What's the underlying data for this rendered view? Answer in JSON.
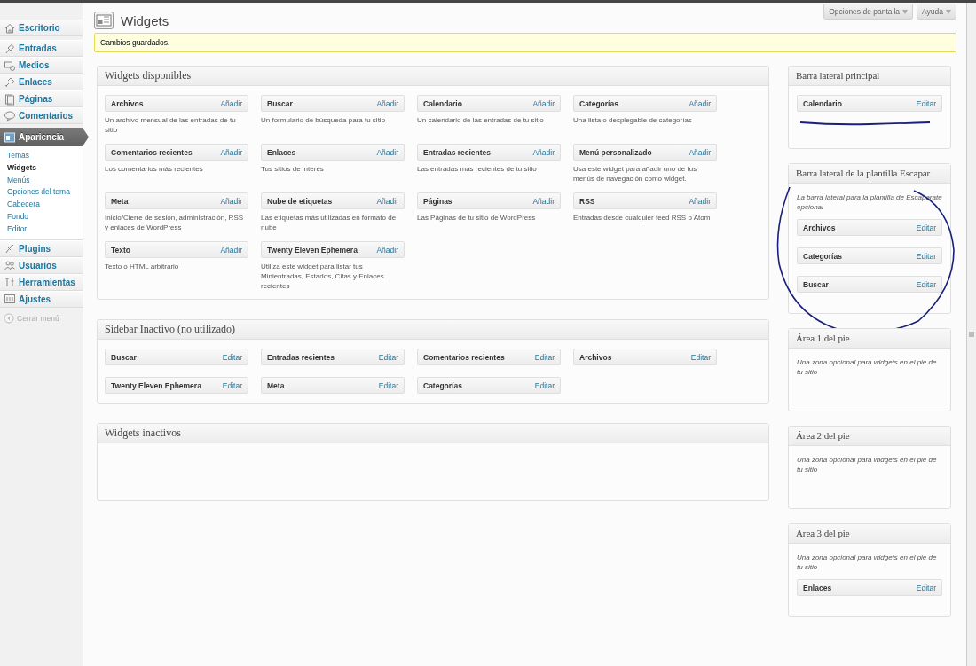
{
  "admin_menu": {
    "groups": [
      [
        {
          "label": "Escritorio",
          "selected": false
        }
      ],
      [
        {
          "label": "Entradas",
          "selected": false
        },
        {
          "label": "Medios",
          "selected": false
        },
        {
          "label": "Enlaces",
          "selected": false
        },
        {
          "label": "Páginas",
          "selected": false
        },
        {
          "label": "Comentarios",
          "selected": false
        }
      ],
      [
        {
          "label": "Apariencia",
          "selected": true,
          "children": [
            {
              "label": "Temas",
              "selected": false
            },
            {
              "label": "Widgets",
              "selected": true
            },
            {
              "label": "Menús",
              "selected": false
            },
            {
              "label": "Opciones del tema",
              "selected": false
            },
            {
              "label": "Cabecera",
              "selected": false
            },
            {
              "label": "Fondo",
              "selected": false
            },
            {
              "label": "Editor",
              "selected": false
            }
          ]
        },
        {
          "label": "Plugins",
          "selected": false
        },
        {
          "label": "Usuarios",
          "selected": false
        },
        {
          "label": "Herramientas",
          "selected": false
        },
        {
          "label": "Ajustes",
          "selected": false
        }
      ]
    ],
    "collapse": "Cerrar menú"
  },
  "header": {
    "title": "Widgets",
    "screen_options": "Opciones de pantalla",
    "help": "Ayuda"
  },
  "notice": "Cambios guardados.",
  "available": {
    "title": "Widgets disponibles",
    "widgets": [
      {
        "name": "Archivos",
        "action": "Añadir",
        "description": "Un archivo mensual de las entradas de tu sitio"
      },
      {
        "name": "Buscar",
        "action": "Añadir",
        "description": "Un formulario de búsqueda para tu sitio"
      },
      {
        "name": "Calendario",
        "action": "Añadir",
        "description": "Un calendario de las entradas de tu sitio"
      },
      {
        "name": "Categorías",
        "action": "Añadir",
        "description": "Una lista o desplegable de categorías"
      },
      {
        "name": "Comentarios recientes",
        "action": "Añadir",
        "description": "Los comentarios más recientes"
      },
      {
        "name": "Enlaces",
        "action": "Añadir",
        "description": "Tus sitios de interés"
      },
      {
        "name": "Entradas recientes",
        "action": "Añadir",
        "description": "Las entradas más recientes de tu sitio"
      },
      {
        "name": "Menú personalizado",
        "action": "Añadir",
        "description": "Usa este widget para añadir uno de tus menús de navegación como widget."
      },
      {
        "name": "Meta",
        "action": "Añadir",
        "description": "Inicio/Cierre de sesión, administración, RSS y enlaces de WordPress"
      },
      {
        "name": "Nube de etiquetas",
        "action": "Añadir",
        "description": "Las etiquetas más utilizadas en formato de nube"
      },
      {
        "name": "Páginas",
        "action": "Añadir",
        "description": "Las Páginas de tu sitio de WordPress"
      },
      {
        "name": "RSS",
        "action": "Añadir",
        "description": "Entradas desde cualquier feed RSS o Atom"
      },
      {
        "name": "Texto",
        "action": "Añadir",
        "description": "Texto o HTML arbitrario"
      },
      {
        "name": "Twenty Eleven Ephemera",
        "action": "Añadir",
        "description": "Utiliza este widget para listar tus Minientradas, Estados, Citas y Enlaces recientes"
      }
    ]
  },
  "inactive_sidebar": {
    "title": "Sidebar Inactivo (no utilizado)",
    "widgets": [
      {
        "name": "Buscar",
        "action": "Editar"
      },
      {
        "name": "Entradas recientes",
        "action": "Editar"
      },
      {
        "name": "Comentarios recientes",
        "action": "Editar"
      },
      {
        "name": "Archivos",
        "action": "Editar"
      },
      {
        "name": "Twenty Eleven Ephemera",
        "action": "Editar"
      },
      {
        "name": "Meta",
        "action": "Editar"
      },
      {
        "name": "Categorías",
        "action": "Editar"
      }
    ]
  },
  "inactive_widgets": {
    "title": "Widgets inactivos"
  },
  "sidebars": [
    {
      "title": "Barra lateral principal",
      "widgets": [
        {
          "name": "Calendario",
          "action": "Editar"
        }
      ]
    },
    {
      "title": "Barra lateral de la plantilla Escapar",
      "description": "La barra lateral para la plantilla de Escaparate opcional",
      "widgets": [
        {
          "name": "Archivos",
          "action": "Editar"
        },
        {
          "name": "Categorías",
          "action": "Editar"
        },
        {
          "name": "Buscar",
          "action": "Editar"
        }
      ]
    },
    {
      "title": "Área 1 del pie",
      "description": "Una zona opcional para widgets en el pie de tu sitio"
    },
    {
      "title": "Área 2 del pie",
      "description": "Una zona opcional para widgets en el pie de tu sitio"
    },
    {
      "title": "Área 3 del pie",
      "description": "Una zona opcional para widgets en el pie de tu sitio",
      "widgets": [
        {
          "name": "Enlaces",
          "action": "Editar"
        }
      ]
    }
  ]
}
